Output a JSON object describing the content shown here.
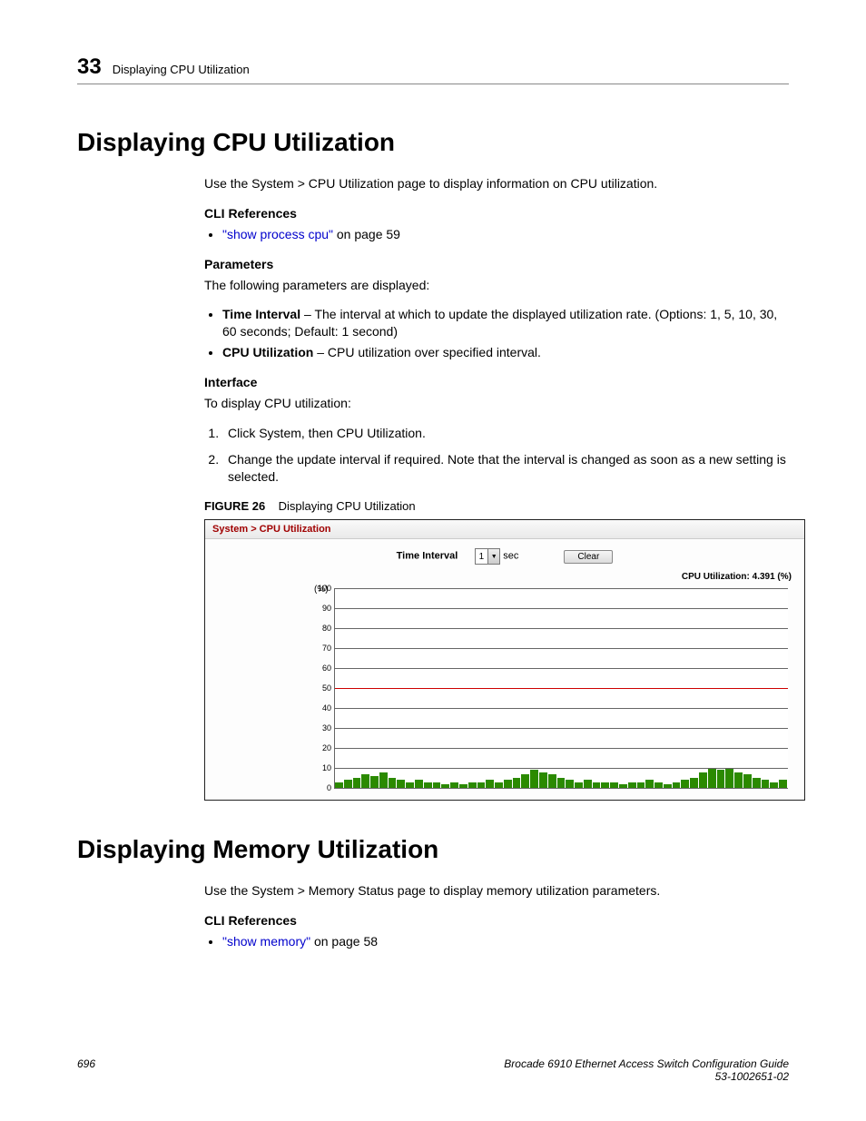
{
  "header": {
    "chapter_number": "33",
    "running_title": "Displaying CPU Utilization"
  },
  "section1": {
    "heading": "Displaying CPU Utilization",
    "intro": "Use the System > CPU Utilization page to display information on CPU utilization.",
    "cli_heading": "CLI References",
    "cli_link": "\"show process cpu\"",
    "cli_link_suffix": " on page 59",
    "params_heading": "Parameters",
    "params_intro": "The following parameters are displayed:",
    "param1_name": "Time Interval",
    "param1_desc": " – The interval at which to update the displayed utilization rate. (Options: 1, 5, 10, 30, 60 seconds; Default: 1 second)",
    "param2_name": "CPU Utilization",
    "param2_desc": " – CPU utilization over specified interval.",
    "interface_heading": "Interface",
    "interface_intro": "To display CPU utilization:",
    "step1": "Click System, then CPU Utilization.",
    "step2": "Change the update interval if required. Note that the interval is changed as soon as a new setting is selected.",
    "figure_label": "FIGURE 26",
    "figure_caption": "Displaying CPU Utilization"
  },
  "ui": {
    "breadcrumb": "System > CPU Utilization",
    "time_interval_label": "Time Interval",
    "time_interval_value": "1",
    "time_interval_unit": "sec",
    "clear_button": "Clear",
    "cpu_util_text": "CPU Utilization: 4.391 (%)",
    "y_unit": "(%)",
    "y_ticks": [
      "100",
      "90",
      "80",
      "70",
      "60",
      "50",
      "40",
      "30",
      "20",
      "10",
      "0"
    ]
  },
  "chart_data": {
    "type": "area",
    "title": "CPU Utilization",
    "ylabel": "(%)",
    "ylim": [
      0,
      100
    ],
    "midline_value": 50,
    "current_value": 4.391,
    "values": [
      3,
      4,
      5,
      7,
      6,
      8,
      5,
      4,
      3,
      4,
      3,
      3,
      2,
      3,
      2,
      3,
      3,
      4,
      3,
      4,
      5,
      7,
      9,
      8,
      7,
      5,
      4,
      3,
      4,
      3,
      3,
      3,
      2,
      3,
      3,
      4,
      3,
      2,
      3,
      4,
      5,
      8,
      10,
      9,
      10,
      8,
      7,
      5,
      4,
      3,
      4
    ]
  },
  "section2": {
    "heading": "Displaying Memory Utilization",
    "intro": "Use the System > Memory Status page to display memory utilization parameters.",
    "cli_heading": "CLI References",
    "cli_link": "\"show memory\"",
    "cli_link_suffix": " on page 58"
  },
  "footer": {
    "page_number": "696",
    "doc_title": "Brocade 6910 Ethernet Access Switch Configuration Guide",
    "doc_id": "53-1002651-02"
  }
}
